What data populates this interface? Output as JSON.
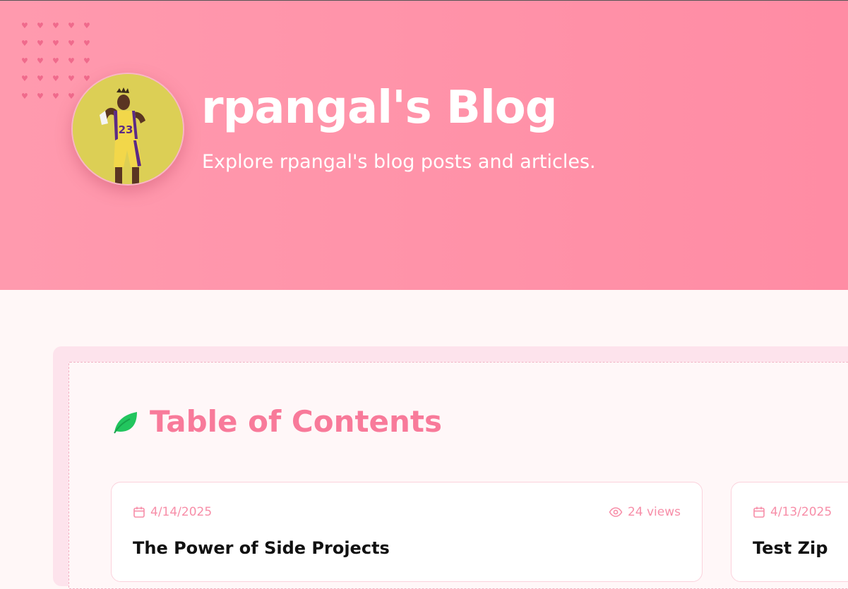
{
  "header": {
    "title": "rpangal's Blog",
    "subtitle": "Explore rpangal's blog posts and articles.",
    "avatar_jersey_number": "23"
  },
  "toc": {
    "heading": "Table of Contents",
    "posts": [
      {
        "date": "4/14/2025",
        "views": "24 views",
        "title": "The Power of Side Projects"
      },
      {
        "date": "4/13/2025",
        "title": "Test Zip"
      }
    ]
  },
  "colors": {
    "hero_background": "#ff8fa6",
    "accent_pink": "#f87a9a",
    "leaf_green": "#22c55e",
    "page_background": "#fff7f7"
  },
  "icons": {
    "decoration": "heart-icon",
    "toc_heading": "leaf-icon",
    "post_date": "calendar-icon",
    "post_views": "eye-icon"
  }
}
